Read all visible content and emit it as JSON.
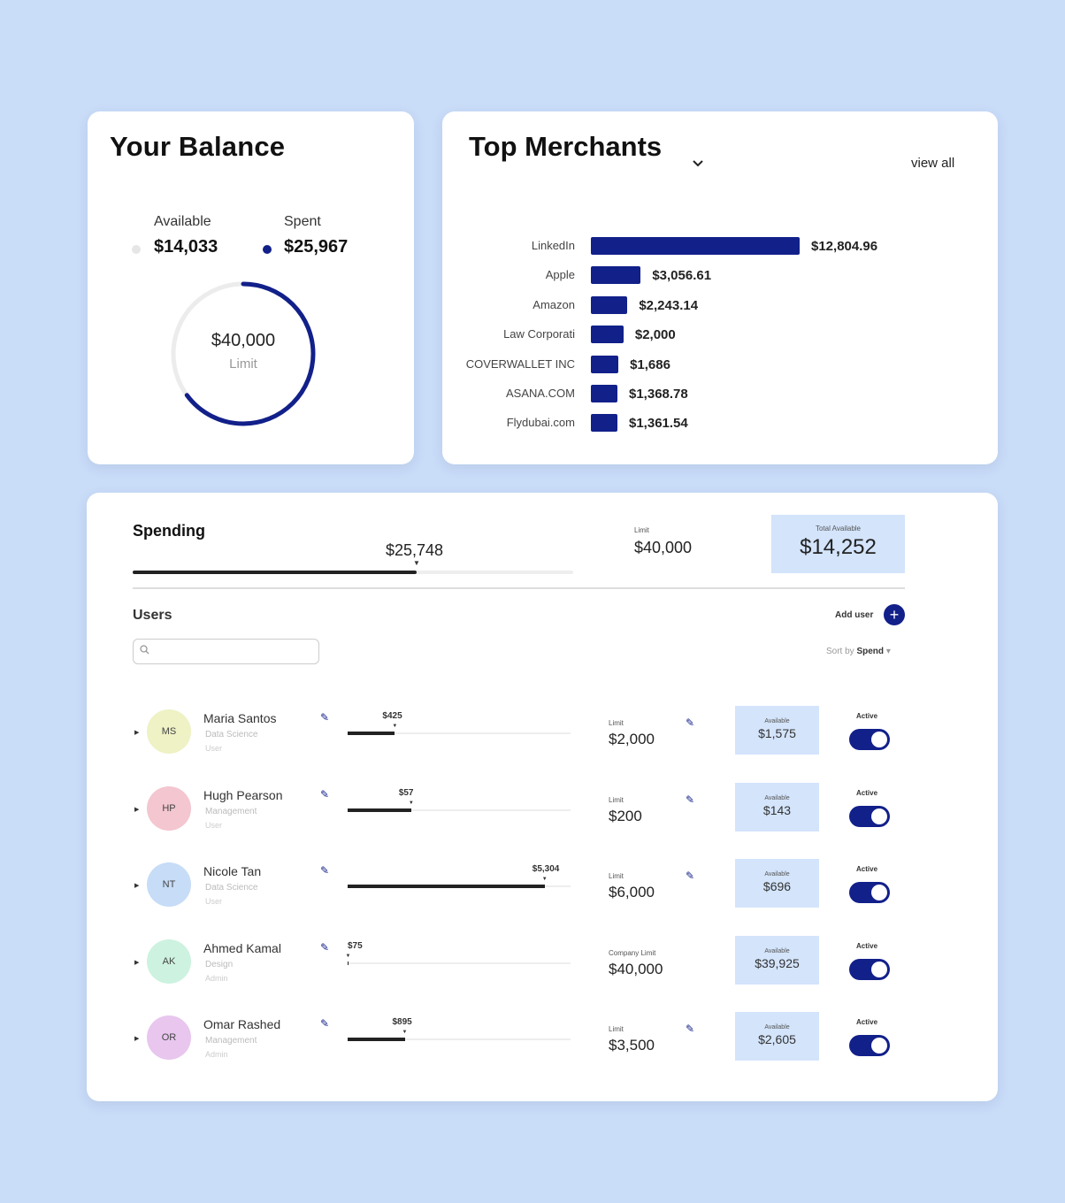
{
  "balance": {
    "title": "Your Balance",
    "available_label": "Available",
    "available_value": "$14,033",
    "spent_label": "Spent",
    "spent_value": "$25,967",
    "limit_value": "$40,000",
    "limit_label": "Limit",
    "spent_fraction": 0.649,
    "colors": {
      "available_dot": "#e6e6e6",
      "spent": "#12208a",
      "track": "#ececec"
    }
  },
  "merchants": {
    "title": "Top Merchants",
    "dropdown_icon": "chevron-down-icon",
    "view_all": "view all",
    "bar_color": "#12208a",
    "max_value": 12804.96,
    "items": [
      {
        "name": "LinkedIn",
        "value": 12804.96,
        "label": "$12,804.96"
      },
      {
        "name": "Apple",
        "value": 3056.61,
        "label": "$3,056.61"
      },
      {
        "name": "Amazon",
        "value": 2243.14,
        "label": "$2,243.14"
      },
      {
        "name": "Law Corporati",
        "value": 2000,
        "label": "$2,000"
      },
      {
        "name": "COVERWALLET INC",
        "value": 1686,
        "label": "$1,686"
      },
      {
        "name": "ASANA.COM",
        "value": 1368.78,
        "label": "$1,368.78"
      },
      {
        "name": "Flydubai.com",
        "value": 1361.54,
        "label": "$1,361.54"
      }
    ]
  },
  "spending": {
    "title": "Spending",
    "spent_value": "$25,748",
    "spent_fraction": 0.644,
    "limit_label": "Limit",
    "limit_value": "$40,000",
    "total_available_label": "Total Available",
    "total_available_value": "$14,252",
    "users_title": "Users",
    "add_user_label": "Add user",
    "search_placeholder": "",
    "sort_label": "Sort by",
    "sort_value": "Spend"
  },
  "users": [
    {
      "initials": "MS",
      "name": "Maria Santos",
      "dept": "Data Science",
      "role": "User",
      "spent": "$425",
      "spent_fraction": 0.212,
      "limit_label": "Limit",
      "limit": "$2,000",
      "available_label": "Available",
      "available": "$1,575",
      "active_label": "Active",
      "active": true,
      "avatar_color": "#eef2c4",
      "editable_limit": true
    },
    {
      "initials": "HP",
      "name": "Hugh Pearson",
      "dept": "Management",
      "role": "User",
      "spent": "$57",
      "spent_fraction": 0.285,
      "limit_label": "Limit",
      "limit": "$200",
      "available_label": "Available",
      "available": "$143",
      "active_label": "Active",
      "active": true,
      "avatar_color": "#f3c6d0",
      "editable_limit": true
    },
    {
      "initials": "NT",
      "name": "Nicole Tan",
      "dept": "Data Science",
      "role": "User",
      "spent": "$5,304",
      "spent_fraction": 0.884,
      "limit_label": "Limit",
      "limit": "$6,000",
      "available_label": "Available",
      "available": "$696",
      "active_label": "Active",
      "active": true,
      "avatar_color": "#c6dcf7",
      "editable_limit": true
    },
    {
      "initials": "AK",
      "name": "Ahmed Kamal",
      "dept": "Design",
      "role": "Admin",
      "spent": "$75",
      "spent_fraction": 0.002,
      "limit_label": "Company Limit",
      "limit": "$40,000",
      "available_label": "Available",
      "available": "$39,925",
      "active_label": "Active",
      "active": true,
      "avatar_color": "#cdf2e0",
      "editable_limit": false
    },
    {
      "initials": "OR",
      "name": "Omar Rashed",
      "dept": "Management",
      "role": "Admin",
      "spent": "$895",
      "spent_fraction": 0.256,
      "limit_label": "Limit",
      "limit": "$3,500",
      "available_label": "Available",
      "available": "$2,605",
      "active_label": "Active",
      "active": true,
      "avatar_color": "#e8c6ee",
      "editable_limit": true
    }
  ]
}
